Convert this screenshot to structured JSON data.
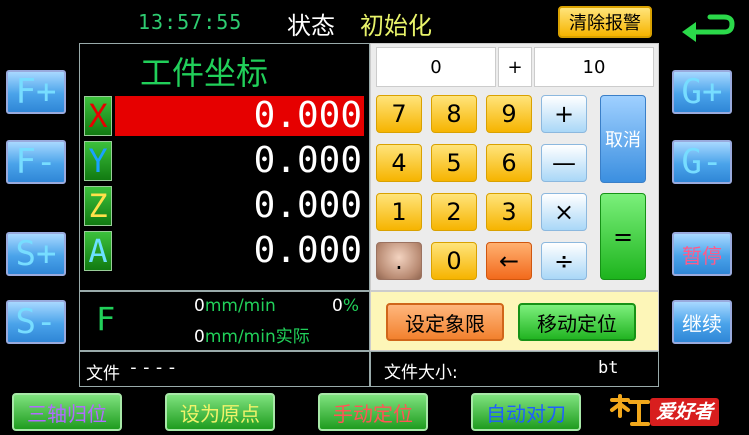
{
  "status_bar": {
    "time": "13:57:55",
    "state_label": "状态",
    "state_value": "初始化",
    "clear_alarm": "清除报警"
  },
  "left_buttons": [
    "F+",
    "F-",
    "S+",
    "S-"
  ],
  "right_buttons": [
    "G+",
    "G-",
    "暂停",
    "继续"
  ],
  "coords": {
    "title": "工件坐标",
    "axes": [
      {
        "name": "X",
        "value": "0.000",
        "selected": true
      },
      {
        "name": "Y",
        "value": "0.000",
        "selected": false
      },
      {
        "name": "Z",
        "value": "0.000",
        "selected": false
      },
      {
        "name": "A",
        "value": "0.000",
        "selected": false
      }
    ]
  },
  "feed": {
    "label": "F",
    "speed_value": "0",
    "speed_unit": "mm/min",
    "percent_value": "0",
    "percent_sign": "%",
    "actual_value": "0",
    "actual_unit": "mm/min实际"
  },
  "file": {
    "label": "文件",
    "name": "----",
    "size_label": "文件大小:",
    "size_unit": "bt"
  },
  "calculator": {
    "operand1": "0",
    "operator": "+",
    "operand2": "10",
    "keys": {
      "k7": "7",
      "k8": "8",
      "k9": "9",
      "k4": "4",
      "k5": "5",
      "k6": "6",
      "k1": "1",
      "k2": "2",
      "k3": "3",
      "dot": ".",
      "k0": "0",
      "back": "←",
      "plus": "+",
      "minus": "—",
      "mul": "×",
      "div": "÷",
      "cancel": "取消",
      "equals": "="
    },
    "set_quadrant": "设定象限",
    "move_position": "移动定位"
  },
  "bottom_buttons": {
    "home_three_axes": "三轴归位",
    "set_origin": "设为原点",
    "manual_position": "手动定位",
    "auto_tool": "自动对刀"
  },
  "logo_text": "爱好者",
  "colors": {
    "accent_green": "#21d05a",
    "selected_axis": "#e60000",
    "time_green": "#2ecc71"
  }
}
